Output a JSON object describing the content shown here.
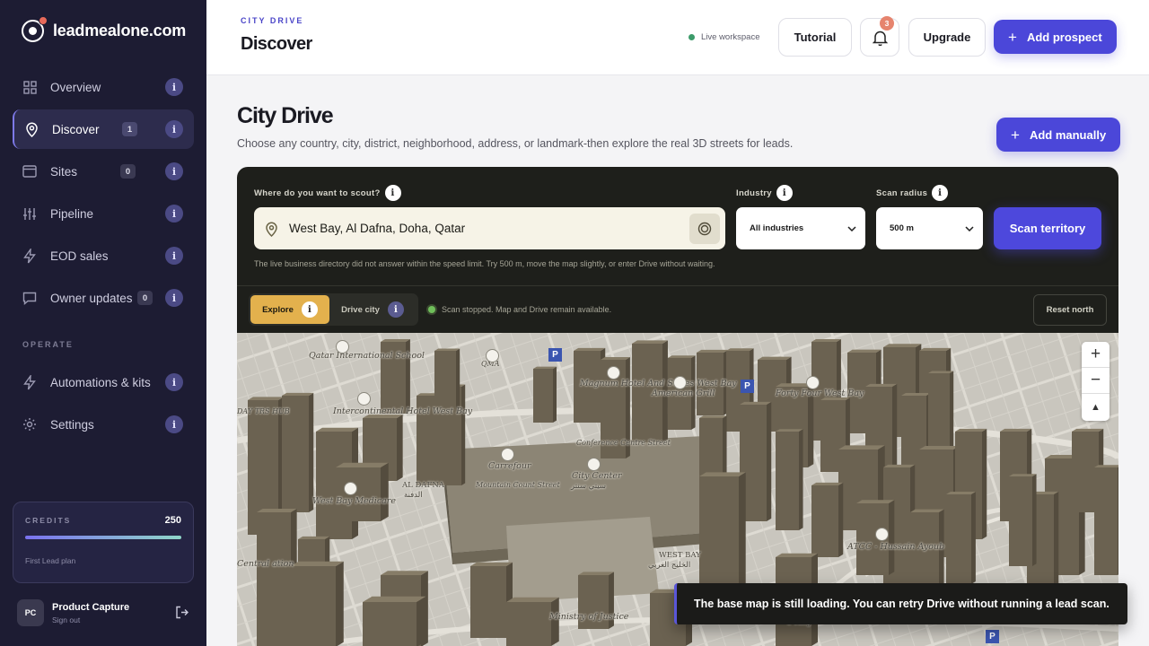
{
  "brand": {
    "name": "leadmealone.com"
  },
  "sidebar": {
    "items": [
      {
        "label": "Overview",
        "icon": "grid-icon"
      },
      {
        "label": "Discover",
        "icon": "map-pin-icon",
        "count": "1",
        "active": true
      },
      {
        "label": "Sites",
        "icon": "browser-icon",
        "count": "0"
      },
      {
        "label": "Pipeline",
        "icon": "sliders-icon"
      },
      {
        "label": "EOD sales",
        "icon": "bolt-icon"
      },
      {
        "label": "Owner updates",
        "icon": "chat-icon",
        "count": "0"
      }
    ],
    "section_label": "OPERATE",
    "operate_items": [
      {
        "label": "Automations & kits",
        "icon": "bolt-icon"
      },
      {
        "label": "Settings",
        "icon": "gear-icon"
      }
    ],
    "info_glyph": "i",
    "credits": {
      "label": "CREDITS",
      "value": "250",
      "plan": "First Lead plan",
      "fill_fraction": 1.0
    },
    "user": {
      "initials": "PC",
      "name": "Product Capture",
      "action": "Sign out"
    }
  },
  "header": {
    "eyebrow": "CITY DRIVE",
    "title": "Discover",
    "live_label": "Live workspace",
    "tutorial": "Tutorial",
    "notifications": "3",
    "upgrade": "Upgrade",
    "add_prospect": "Add prospect"
  },
  "page": {
    "title": "City Drive",
    "subtitle": "Choose any country, city, district, neighborhood, address, or landmark-then explore the real 3D streets for leads.",
    "add_manually": "Add manually"
  },
  "search": {
    "location_label": "Where do you want to scout?",
    "location_value": "West Bay, Al Dafna, Doha, Qatar",
    "industry_label": "Industry",
    "industry_value": "All industries",
    "radius_label": "Scan radius",
    "radius_value": "500 m",
    "scan_button": "Scan territory",
    "notice": "The live business directory did not answer within the speed limit. Try 500 m, move the map slightly, or enter Drive without waiting."
  },
  "modes": {
    "explore": "Explore",
    "drive": "Drive city",
    "active": "Explore",
    "status": "Scan stopped. Map and Drive remain available.",
    "reset_north": "Reset north"
  },
  "map": {
    "labels": [
      "Qatar International School",
      "Intercontinental Hotel West Bay",
      "Magnum Hotel And Suites West Bay",
      "American Grill",
      "Forty Four West Bay",
      "Carrefour",
      "City Center",
      "Conference Centre Street",
      "Mountain Count Street",
      "AL DAFNA",
      "West Bay Medicare",
      "WEST BAY",
      "ATCC - Hussain Ayoub",
      "Ministry of Justice",
      "DAY TRS HUB",
      "Central ation",
      "QMA",
      "C Ring"
    ],
    "arabic": [
      "سيتي سنتر",
      "الدفنة",
      "الخليج الغربي"
    ],
    "zoom_in": "+",
    "zoom_out": "−",
    "compass": "▲",
    "parking": "P"
  },
  "toast": {
    "message": "The base map is still loading. You can retry Drive without running a lead scan."
  }
}
